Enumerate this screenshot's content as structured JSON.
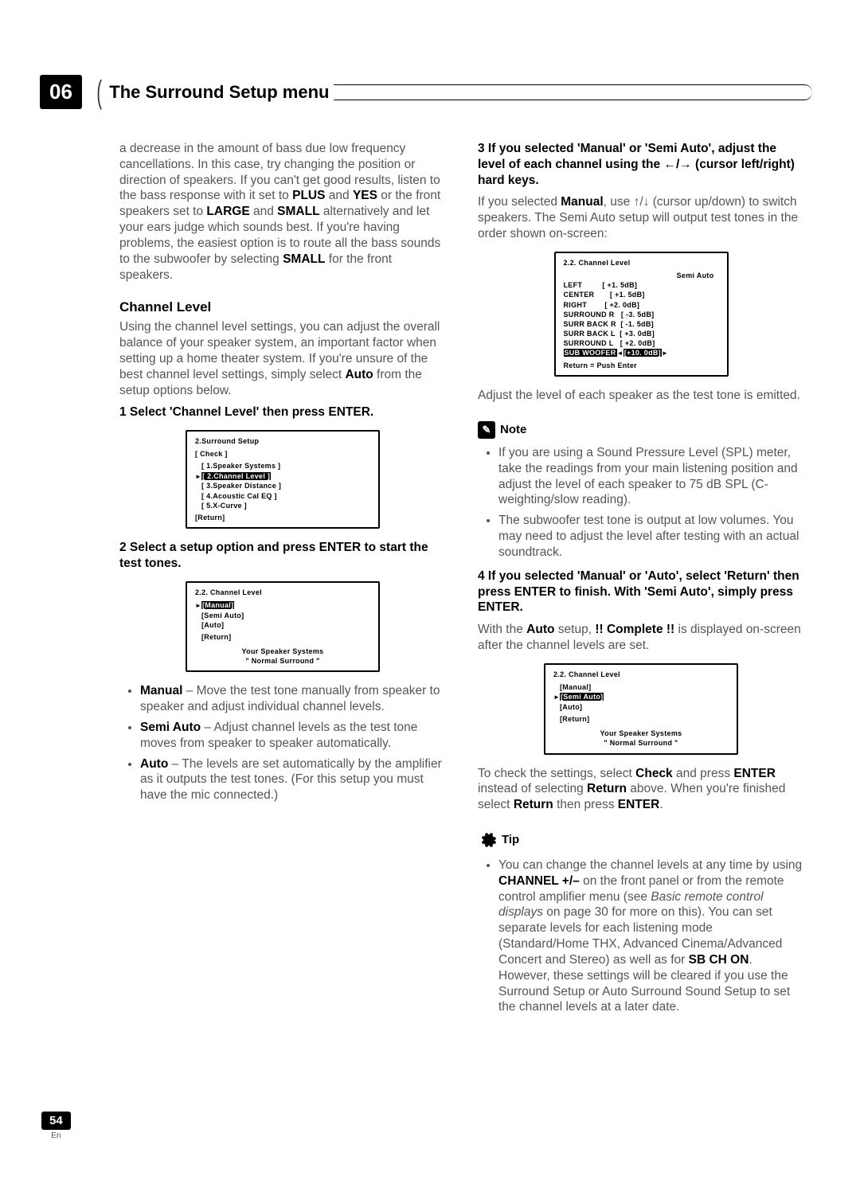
{
  "chapter": {
    "num": "06",
    "title": "The Surround Setup menu"
  },
  "left": {
    "intro1a": "a decrease in the amount of bass due low frequency cancellations. In this case, try changing the position or direction of speakers. If you can't get good results, listen to the bass response with it set to ",
    "intro1b": "PLUS",
    "intro1c": " and ",
    "intro1d": "YES",
    "intro1e": " or the front speakers set to ",
    "intro1f": "LARGE",
    "intro1g": " and ",
    "intro1h": "SMALL",
    "intro1i": " alternatively and let your ears judge which sounds best. If you're having problems, the easiest option is to route all the bass sounds to the subwoofer by selecting ",
    "intro1j": "SMALL",
    "intro1k": " for the front speakers.",
    "h_channel": "Channel Level",
    "channel_intro_a": "Using the channel level settings, you can adjust the overall balance of your speaker system, an important factor when setting up a home theater system. If you're unsure of the best channel level settings, simply select ",
    "channel_intro_b": "Auto",
    "channel_intro_c": " from the setup options below.",
    "step1": "1    Select 'Channel Level' then press ENTER.",
    "osd1": {
      "title": "2.Surround Setup",
      "check": "[ Check ]",
      "l1": "[ 1.Speaker Systems ]",
      "l2": "[ 2.Channel Level ]",
      "l3": "[ 3.Speaker Distance ]",
      "l4": "[ 4.Acoustic Cal EQ ]",
      "l5": "[ 5.X-Curve ]",
      "ret": "[Return]"
    },
    "step2": "2    Select a setup option and press ENTER to start the test tones.",
    "osd2": {
      "title": "2.2. Channel  Level",
      "o1": "[Manual]",
      "o2": "[Semi  Auto]",
      "o3": "[Auto]",
      "ret": "[Return]",
      "sys1": "Your  Speaker  Systems",
      "sys2": "\"  Normal  Surround  \""
    },
    "b1a": "Manual",
    "b1b": " – Move the test tone manually from speaker to speaker and adjust individual channel levels.",
    "b2a": "Semi Auto",
    "b2b": " – Adjust channel levels as the test tone moves from speaker to speaker automatically.",
    "b3a": "Auto",
    "b3b": " – The levels are set automatically by the amplifier as it outputs the test tones. (For this setup you must have the mic connected.)"
  },
  "right": {
    "step3a": "3    If you selected 'Manual' or 'Semi Auto', adjust the level of each channel using the ",
    "step3b": " (cursor left/right) hard keys.",
    "step3arrows": "←/→",
    "p3a": "If you selected ",
    "p3b": "Manual",
    "p3c": ", use ",
    "p3arrows": "↑/↓",
    "p3d": " (cursor up/down) to switch speakers. The Semi Auto setup will output test tones in the order shown on-screen:",
    "osd3": {
      "title": "2.2. Channel  Level",
      "mode": "Semi  Auto",
      "rows": [
        [
          "LEFT",
          "[ +1. 5dB]"
        ],
        [
          "CENTER",
          "[ +1. 5dB]"
        ],
        [
          "RIGHT",
          "[ +2. 0dB]"
        ],
        [
          "SURROUND R",
          "[ -3. 5dB]"
        ],
        [
          "SURR BACK R",
          "[ -1. 5dB]"
        ],
        [
          "SURR BACK L",
          "[ +3. 0dB]"
        ],
        [
          "SURROUND L",
          "[ +2. 0dB]"
        ],
        [
          "SUB WOOFER",
          "[+10. 0dB]"
        ]
      ],
      "ret": "Return = Push  Enter"
    },
    "p4": "Adjust the level of each speaker as the test tone is emitted.",
    "note_label": "Note",
    "note1": "If you are using a Sound Pressure Level (SPL) meter, take the readings from your main listening position and adjust the level of each speaker to 75 dB SPL (C-weighting/slow reading).",
    "note2": "The subwoofer test tone is output at low volumes. You may need to adjust the level after testing with an actual soundtrack.",
    "step4": "4    If you selected 'Manual' or 'Auto', select 'Return' then press ENTER to finish. With 'Semi Auto', simply press ENTER.",
    "p5a": "With the ",
    "p5b": "Auto",
    "p5c": " setup, ",
    "p5d": "!! Complete !!",
    "p5e": " is displayed on-screen after the channel levels are set.",
    "osd4": {
      "title": "2.2. Channel  Level",
      "o1": "[Manual]",
      "o2": "[Semi  Auto]",
      "o3": "[Auto]",
      "ret": "[Return]",
      "sys1": "Your  Speaker  Systems",
      "sys2": "\"  Normal  Surround  \""
    },
    "p6a": "To check the settings, select ",
    "p6b": "Check",
    "p6c": " and press ",
    "p6d": "ENTER",
    "p6e": " instead of selecting ",
    "p6f": "Return",
    "p6g": " above. When you're finished select ",
    "p6h": "Return",
    "p6i": " then press ",
    "p6j": "ENTER",
    "p6k": ".",
    "tip_label": "Tip",
    "tip1a": "You can change the channel levels at any time by using ",
    "tip1b": "CHANNEL  +/–",
    "tip1c": " on the front panel or from the remote control amplifier menu (see ",
    "tip1d": "Basic remote control displays",
    "tip1e": " on page 30 for more on this). You can set separate levels for each listening mode (Standard/Home THX, Advanced Cinema/Advanced Concert and Stereo) as well as for ",
    "tip1f": "SB CH ON",
    "tip1g": ". However, these settings will be cleared if you use the Surround Setup or Auto Surround Sound Setup to set the channel levels at a later date."
  },
  "footer": {
    "page": "54",
    "lang": "En"
  }
}
